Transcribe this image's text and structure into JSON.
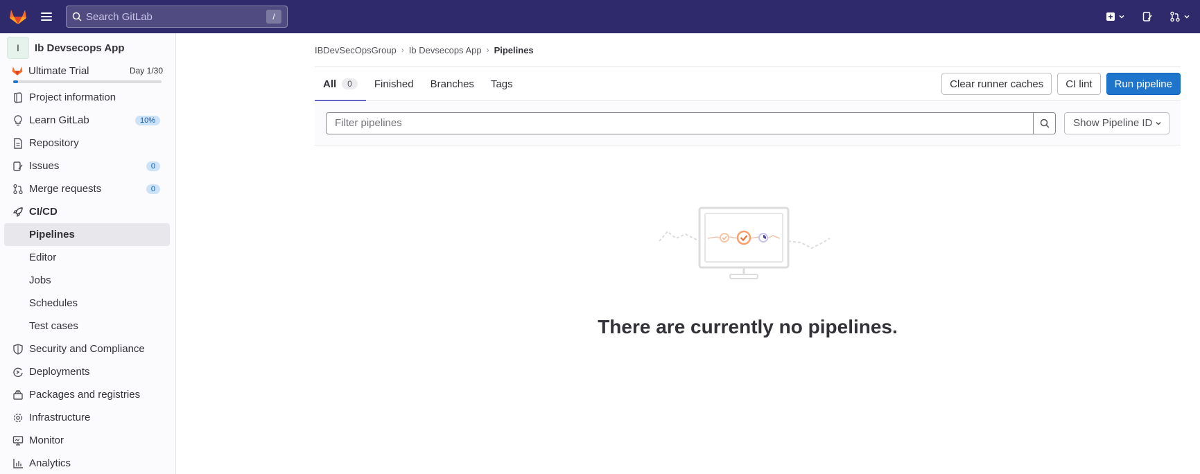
{
  "topbar": {
    "search_placeholder": "Search GitLab",
    "search_shortcut": "/"
  },
  "sidebar": {
    "project_initial": "I",
    "project_name": "Ib Devsecops App",
    "trial": {
      "label": "Ultimate Trial",
      "day": "Day 1/30",
      "progress": 0.033
    },
    "items": [
      {
        "label": "Project information"
      },
      {
        "label": "Learn GitLab",
        "badge": "10%"
      },
      {
        "label": "Repository"
      },
      {
        "label": "Issues",
        "badge": "0"
      },
      {
        "label": "Merge requests",
        "badge": "0"
      },
      {
        "label": "CI/CD"
      }
    ],
    "cicd_sub": [
      {
        "label": "Pipelines"
      },
      {
        "label": "Editor"
      },
      {
        "label": "Jobs"
      },
      {
        "label": "Schedules"
      },
      {
        "label": "Test cases"
      }
    ],
    "bottom_items": [
      {
        "label": "Security and Compliance"
      },
      {
        "label": "Deployments"
      },
      {
        "label": "Packages and registries"
      },
      {
        "label": "Infrastructure"
      },
      {
        "label": "Monitor"
      },
      {
        "label": "Analytics"
      }
    ]
  },
  "breadcrumb": [
    "IBDevSecOpsGroup",
    "Ib Devsecops App",
    "Pipelines"
  ],
  "tabs": [
    {
      "label": "All",
      "count": "0"
    },
    {
      "label": "Finished"
    },
    {
      "label": "Branches"
    },
    {
      "label": "Tags"
    }
  ],
  "actions": {
    "clear_caches": "Clear runner caches",
    "ci_lint": "CI lint",
    "run_pipeline": "Run pipeline"
  },
  "filter": {
    "placeholder": "Filter pipelines",
    "select_value": "Show Pipeline ID"
  },
  "empty_state": {
    "title": "There are currently no pipelines."
  },
  "colors": {
    "topbar": "#2f2a6b",
    "primary": "#1f75cb",
    "active_tab": "#6666c4"
  }
}
